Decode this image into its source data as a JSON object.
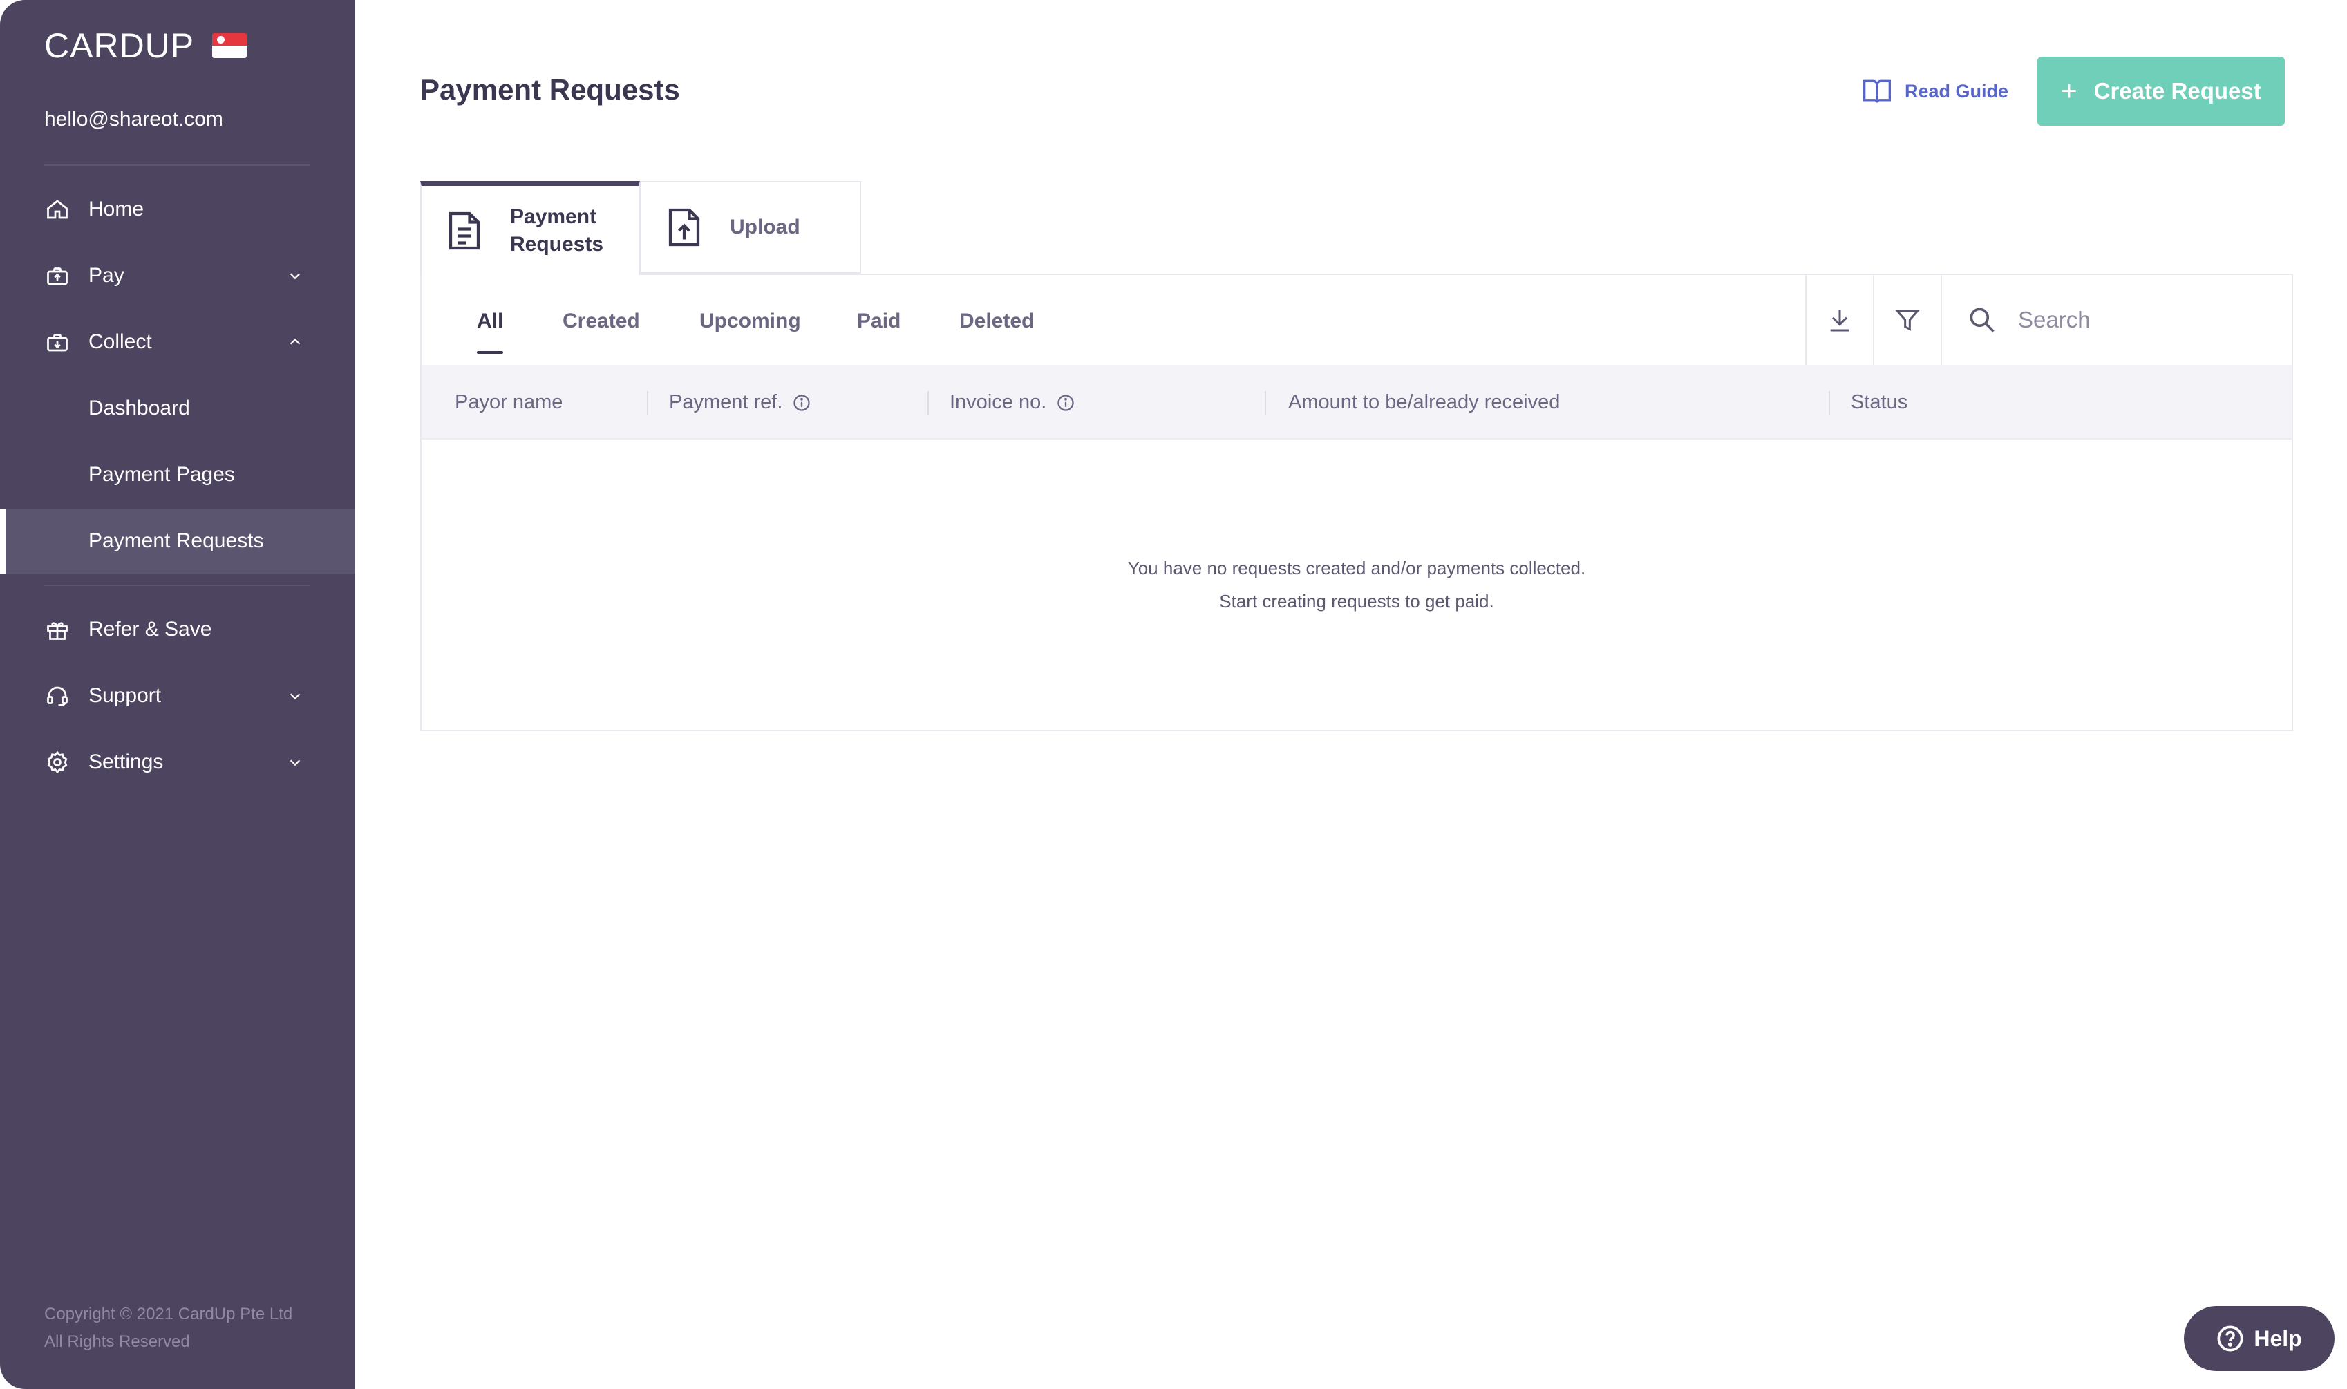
{
  "brand": {
    "logo_text": "CARDUP",
    "flag": "singapore-flag-icon"
  },
  "user": {
    "email": "hello@shareot.com"
  },
  "sidebar": {
    "items": [
      {
        "label": "Home",
        "icon": "home-icon"
      },
      {
        "label": "Pay",
        "icon": "pay-icon"
      },
      {
        "label": "Collect",
        "icon": "collect-icon"
      },
      {
        "label": "Dashboard"
      },
      {
        "label": "Payment Pages"
      },
      {
        "label": "Payment Requests"
      },
      {
        "label": "Refer & Save",
        "icon": "gift-icon"
      },
      {
        "label": "Support",
        "icon": "headset-icon"
      },
      {
        "label": "Settings",
        "icon": "gear-icon"
      }
    ],
    "copyright_line1": "Copyright © 2021 CardUp Pte Ltd",
    "copyright_line2": "All Rights Reserved"
  },
  "header": {
    "title": "Payment Requests",
    "read_guide": "Read Guide",
    "create_request": "Create Request"
  },
  "tabs": [
    {
      "label_line1": "Payment",
      "label_line2": "Requests"
    },
    {
      "label": "Upload"
    }
  ],
  "filters": [
    "All",
    "Created",
    "Upcoming",
    "Paid",
    "Deleted"
  ],
  "search": {
    "placeholder": "Search"
  },
  "table": {
    "columns": [
      "Payor name",
      "Payment ref.",
      "Invoice no.",
      "Amount to be/already received",
      "Status"
    ]
  },
  "empty_state": {
    "line1": "You have no requests created and/or payments collected.",
    "line2": "Start creating requests to get paid."
  },
  "help": {
    "label": "Help"
  },
  "colors": {
    "sidebar": "#4d4560",
    "accent_button": "#6fcfb8",
    "link": "#5765c9"
  }
}
